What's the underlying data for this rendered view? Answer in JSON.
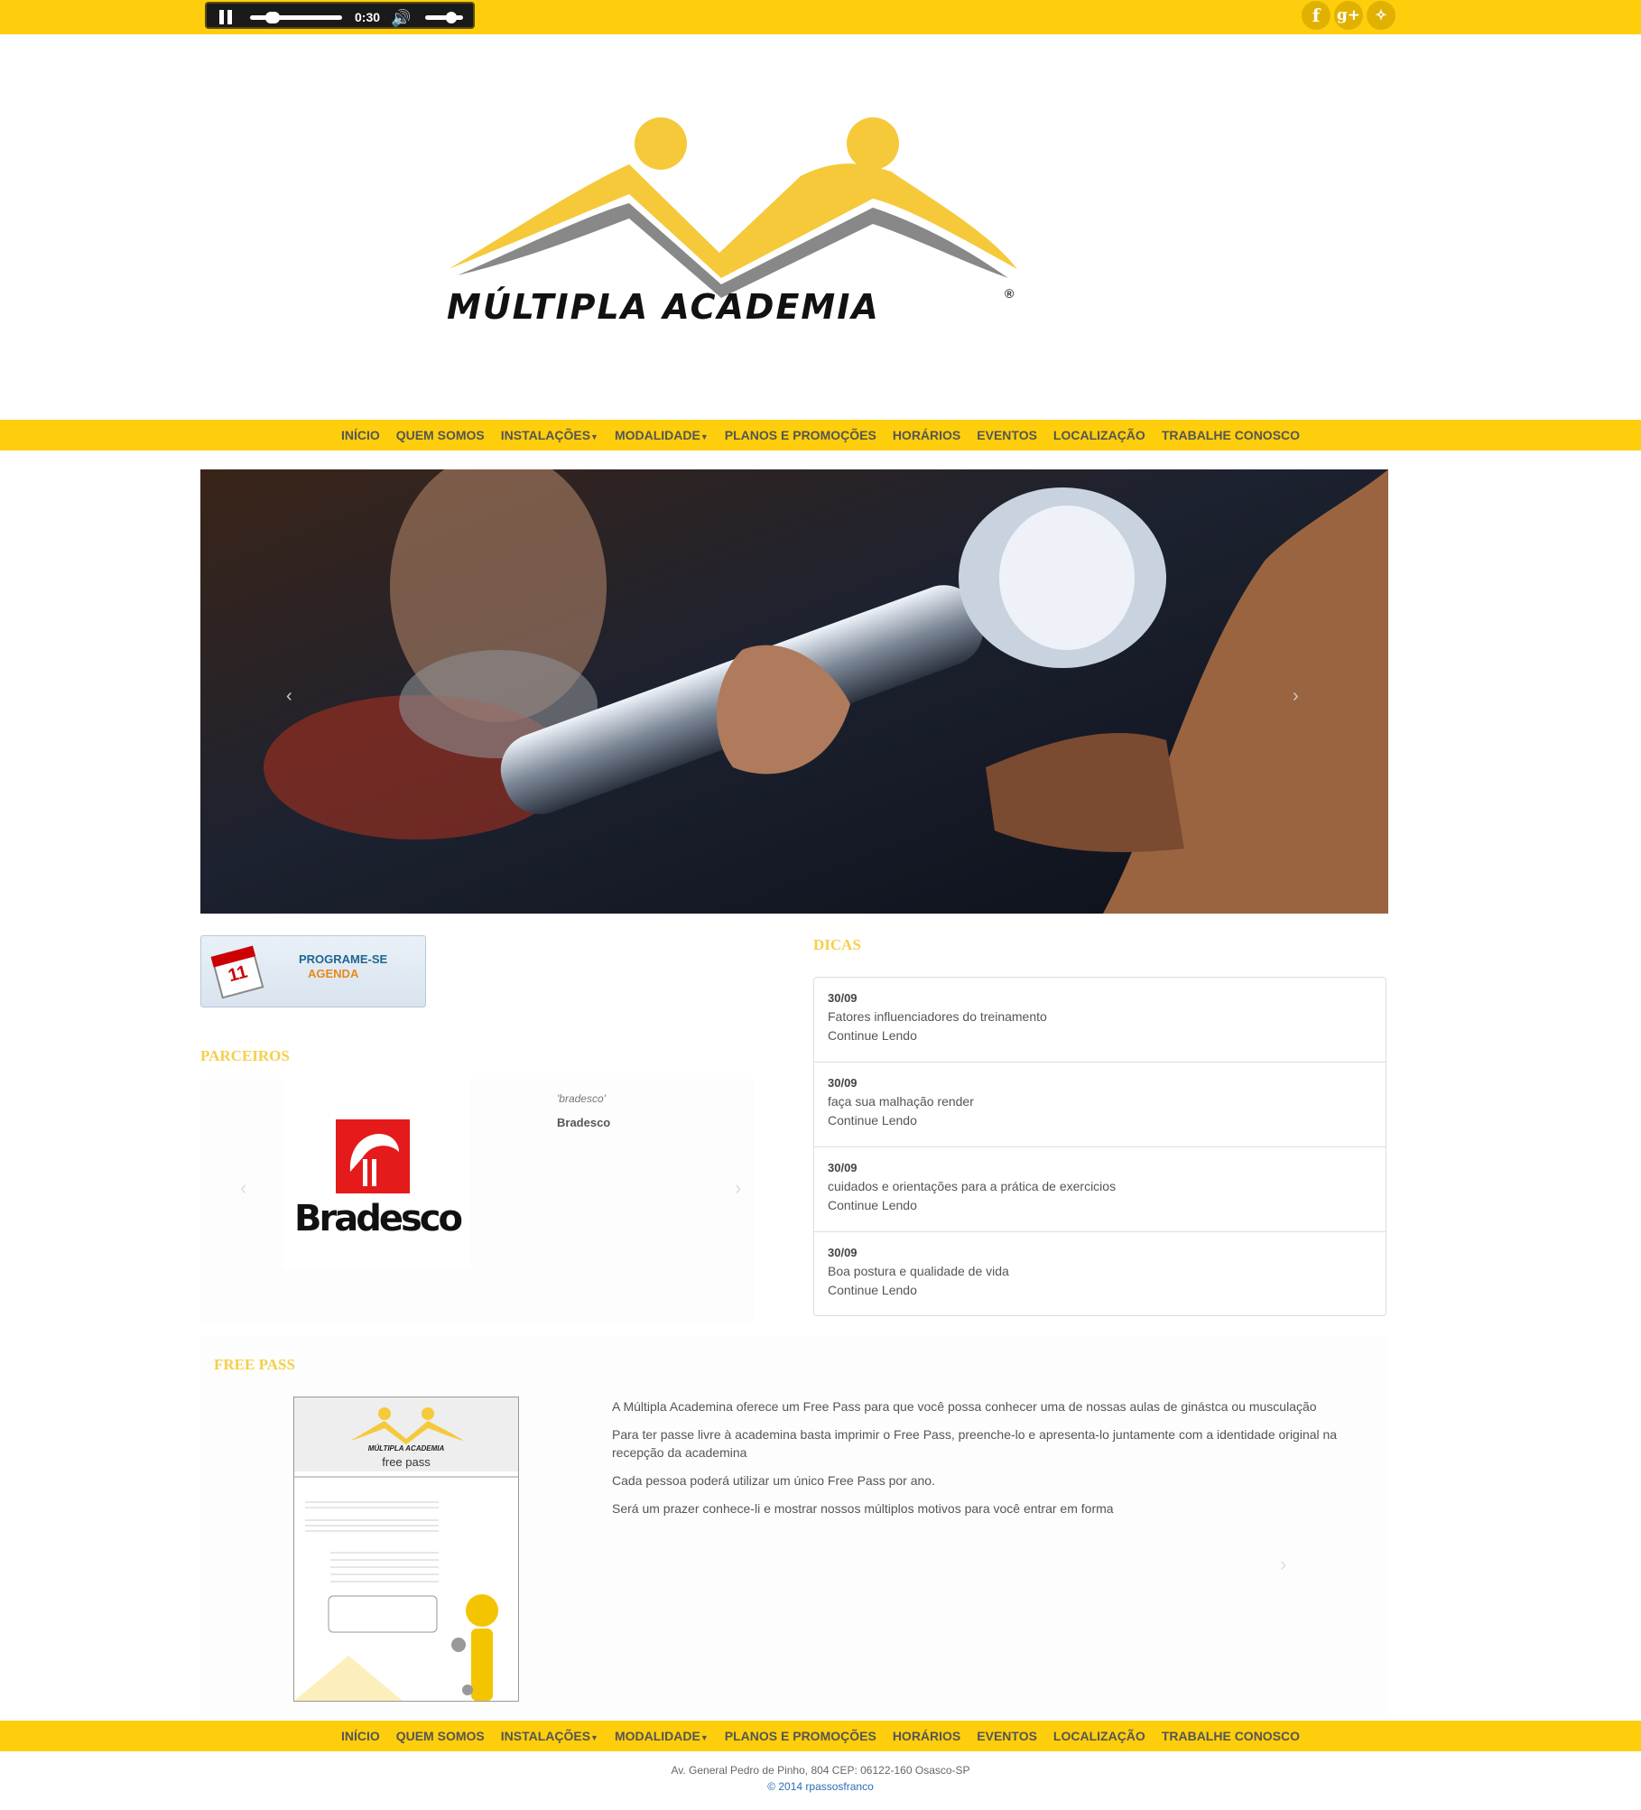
{
  "player": {
    "time": "0:30",
    "progress": 0.2,
    "volume": 0.75
  },
  "social": [
    "facebook-icon",
    "google-plus-icon",
    "twitter-icon"
  ],
  "brand": {
    "name": "MÚLTIPLA ACADEMIA",
    "accent": "#fece0c"
  },
  "nav": [
    "INÍCIO",
    "QUEM SOMOS",
    "INSTALAÇÕES",
    "MODALIDADE",
    "PLANOS E PROMOÇÕES",
    "HORÁRIOS",
    "EVENTOS",
    "LOCALIZAÇÃO",
    "TRABALHE CONOSCO"
  ],
  "hero": {
    "prev": "‹",
    "next": "›"
  },
  "agenda": {
    "day": "11",
    "line1": "PROGRAME-SE",
    "line2": "AGENDA"
  },
  "parceiros": {
    "title": "PARCEIROS",
    "logo_text": "Bradesco",
    "caption_italic": "'bradesco'",
    "caption_name": "Bradesco"
  },
  "dicas": {
    "title": "DICAS",
    "items": [
      {
        "date": "30/09",
        "text": "Fatores influenciadores do treinamento",
        "link": "Continue Lendo"
      },
      {
        "date": "30/09",
        "text": "faça sua malhação render",
        "link": "Continue Lendo"
      },
      {
        "date": "30/09",
        "text": "cuidados e orientações para a prática de exercicios",
        "link": "Continue Lendo"
      },
      {
        "date": "30/09",
        "text": "Boa postura e qualidade de vida",
        "link": "Continue Lendo"
      }
    ]
  },
  "freepass": {
    "title": "FREE PASS",
    "card_brand": "MÚLTIPLA ACADEMIA",
    "card_title": "free pass",
    "paragraphs": [
      "A Múltipla Academina oferece um Free Pass para que você possa conhecer uma de nossas aulas de ginástca ou musculação",
      "Para ter passe livre à academina basta imprimir o Free Pass, preenche-lo e apresenta-lo juntamente com a identidade original na recepção da academina",
      "Cada pessoa poderá utilizar um único Free Pass por ano.",
      "Será um prazer conhece-li e mostrar nossos múltiplos motivos para você entrar em forma"
    ]
  },
  "footer": {
    "address": "Av. General Pedro de Pinho, 804 CEP: 06122-160 Osasco-SP",
    "copyright": "© 2014 rpassosfranco"
  }
}
